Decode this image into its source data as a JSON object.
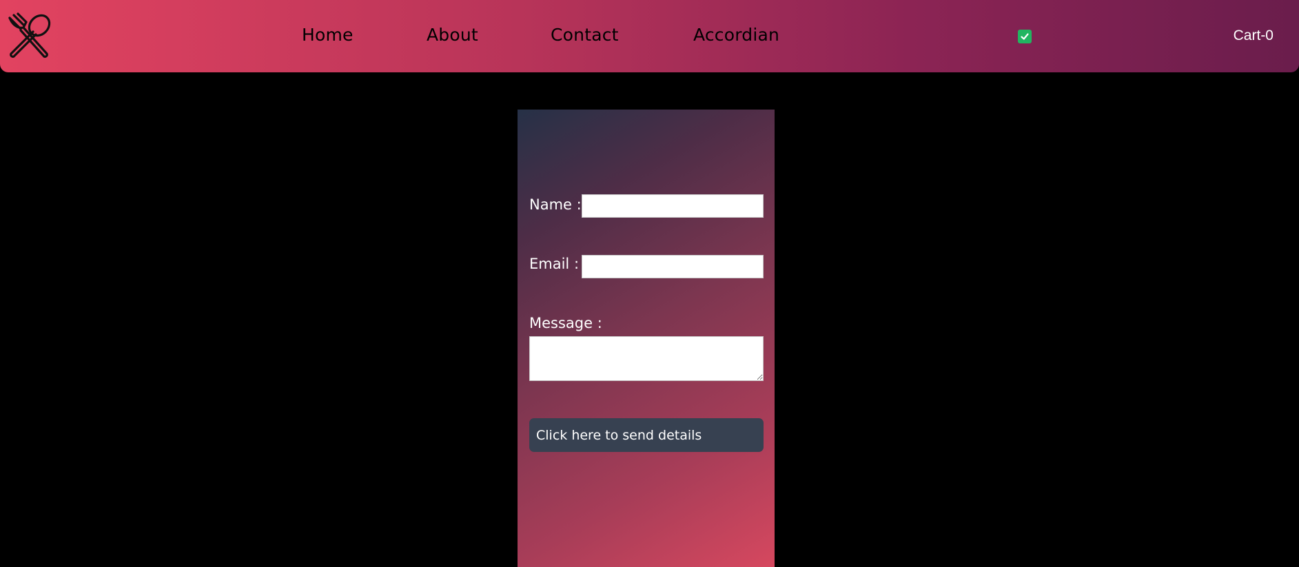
{
  "nav": {
    "logo_icon": "fork-spoon-icon",
    "links": [
      {
        "label": "Home"
      },
      {
        "label": "About"
      },
      {
        "label": "Contact"
      },
      {
        "label": "Accordian"
      }
    ],
    "toggle_icon": "checkbox-checked-icon",
    "toggle_checked": true,
    "cart_label": "Cart-0"
  },
  "form": {
    "name_label": "Name :",
    "name_value": "",
    "email_label": "Email :",
    "email_value": "",
    "message_label": "Message :",
    "message_value": "",
    "submit_label": "Click here to send details"
  },
  "colors": {
    "nav_gradient_start": "#e24360",
    "nav_gradient_end": "#6a1d4c",
    "checkbox_green": "#22b561",
    "button_bg": "#374151",
    "page_bg": "#000000"
  }
}
